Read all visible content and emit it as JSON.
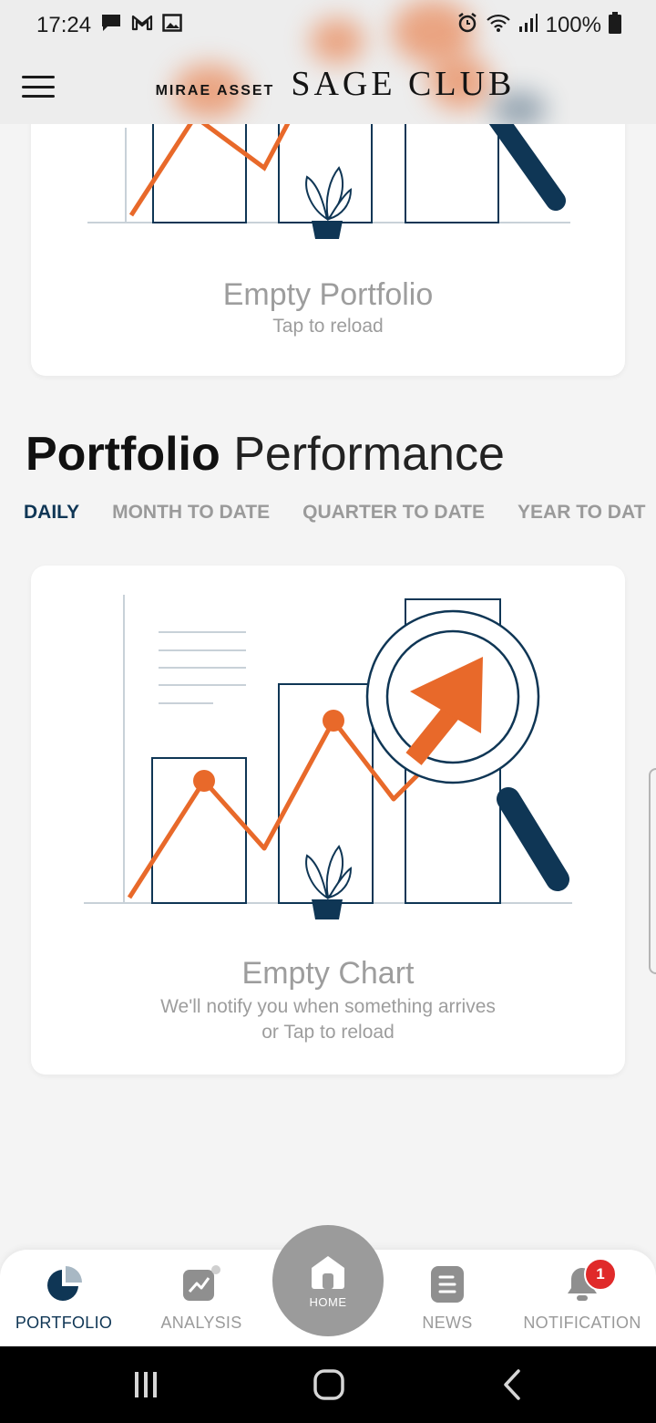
{
  "status_bar": {
    "time": "17:24",
    "battery": "100%",
    "icons": [
      "message-icon",
      "gmail-icon",
      "image-icon",
      "alarm-icon",
      "wifi-icon",
      "signal-icon",
      "battery-icon"
    ]
  },
  "app_bar": {
    "brand_small": "MIRAE ASSET",
    "brand_large": "SAGE CLUB",
    "menu_icon": "hamburger-menu-icon"
  },
  "portfolio_card": {
    "title": "Empty Portfolio",
    "subtitle": "Tap to reload"
  },
  "performance": {
    "title_bold": "Portfolio",
    "title_light": "Performance",
    "tabs": [
      {
        "label": "DAILY",
        "active": true
      },
      {
        "label": "MONTH TO DATE",
        "active": false
      },
      {
        "label": "QUARTER TO DATE",
        "active": false
      },
      {
        "label": "YEAR TO DAT",
        "active": false
      }
    ]
  },
  "chart_card": {
    "title": "Empty Chart",
    "line1": "We'll notify you when something arrives",
    "line2": "or Tap to reload"
  },
  "bottom_nav": {
    "items": [
      {
        "label": "PORTFOLIO",
        "icon": "pie-chart-icon",
        "active": true
      },
      {
        "label": "ANALYSIS",
        "icon": "analysis-chart-icon",
        "active": false
      },
      {
        "label": "NEWS",
        "icon": "news-icon",
        "active": false
      },
      {
        "label": "NOTIFICATION",
        "icon": "bell-icon",
        "active": false
      }
    ],
    "home_label": "HOME",
    "notification_count": "1"
  },
  "colors": {
    "accent_navy": "#0f3655",
    "accent_orange": "#e8692a",
    "muted_gray": "#9a9a9a",
    "badge_red": "#e02a2a"
  }
}
